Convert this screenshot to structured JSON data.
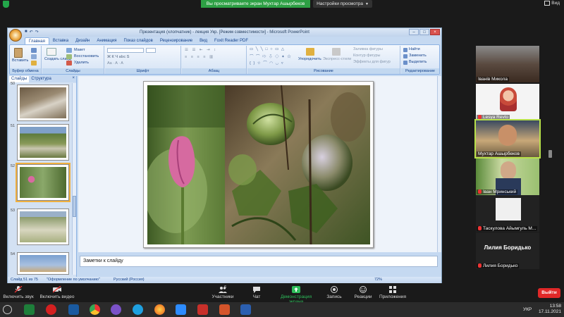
{
  "zoom_top": {
    "share_banner": "Вы просматриваете экран Мухтар Ашырбеков",
    "view_settings": "Настройки просмотра",
    "view_button": "Вид"
  },
  "powerpoint": {
    "window_title": "Презентация (хлопчатник) - лекция Укр. [Режим совместимости] - Microsoft PowerPoint",
    "tabs": [
      "Главная",
      "Вставка",
      "Дизайн",
      "Анимация",
      "Показ слайдов",
      "Рецензирование",
      "Вид",
      "Foxit Reader PDF"
    ],
    "ribbon": {
      "paste": "Вставить",
      "clipboard_group": "Буфер обмена",
      "layout": "Макет",
      "reset": "Восстановить",
      "new_slide": "Создать слайд",
      "delete": "Удалить",
      "slides_group": "Слайды",
      "font_group": "Шрифт",
      "paragraph_group": "Абзац",
      "arrange": "Упорядочить",
      "quick_styles": "Экспресс-стили",
      "shape_fill": "Заливка фигуры",
      "shape_outline": "Контур фигуры",
      "shape_effects": "Эффекты для фигур",
      "drawing_group": "Рисование",
      "find": "Найти",
      "replace": "Заменить",
      "select": "Выделить",
      "editing_group": "Редактирование"
    },
    "panel_tabs": [
      "Слайды",
      "Структура"
    ],
    "thumb_numbers": [
      "50",
      "51",
      "52",
      "53",
      "54"
    ],
    "notes_placeholder": "Заметки к слайду",
    "status": {
      "slide_info": "Слайд 51 из 75",
      "theme": "\"Оформление по умолчанию\"",
      "language": "Русский (Россия)",
      "zoom": "72%"
    }
  },
  "participants": [
    {
      "name": "Іванів Микола",
      "muted": false
    },
    {
      "name": "Lesya Revto",
      "muted": true
    },
    {
      "name": "Мухтар Ашырбеков",
      "muted": false,
      "active": true
    },
    {
      "name": "Іван Мринський",
      "muted": true
    },
    {
      "name": "Таскулова Айымгуль М...",
      "muted": true
    },
    {
      "name": "Лилия Боридько",
      "muted": true,
      "big_name": "Лилия Боридько"
    }
  ],
  "zoom_toolbar": {
    "audio": "Включить звук",
    "video": "Включить видео",
    "participants": "Участники",
    "participants_count": "6",
    "chat": "Чат",
    "share": "Демонстрация экрана",
    "record": "Запись",
    "reactions": "Реакции",
    "apps": "Приложения",
    "leave": "Выйти"
  },
  "taskbar": {
    "lang": "УКР",
    "time": "13:58",
    "date": "17.11.2021"
  },
  "colors": {
    "zoom_green": "#2da044",
    "leave_red": "#e02828",
    "active_speaker": "#b7e04a",
    "ribbon_blue": "#15428b"
  }
}
